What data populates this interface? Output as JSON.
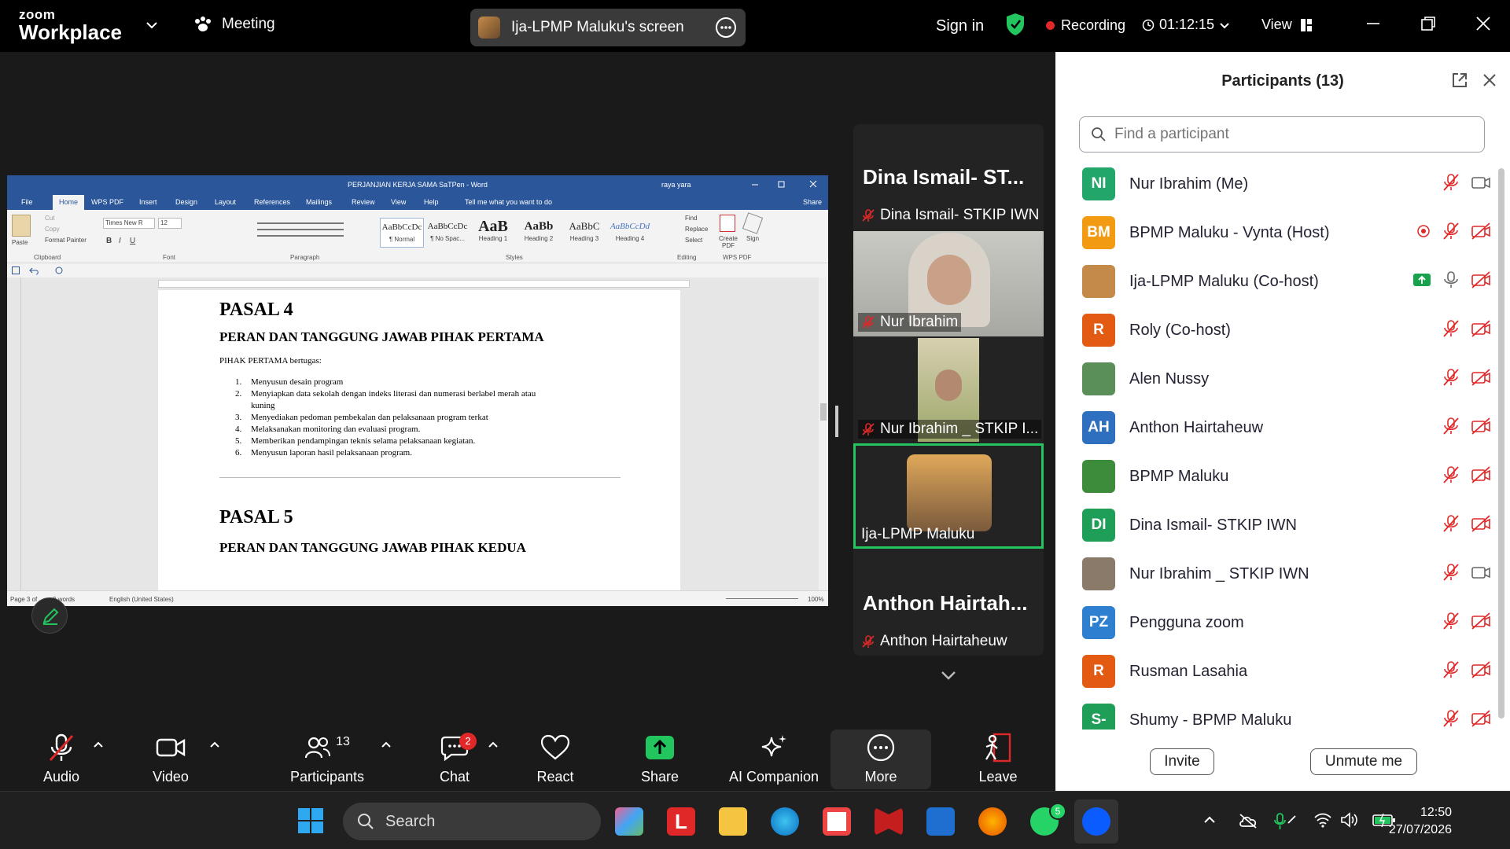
{
  "app": {
    "logo_line1": "zoom",
    "logo_line2": "Workplace",
    "meeting_label": "Meeting",
    "screen_share_label": "Ija-LPMP Maluku's screen",
    "sign_in": "Sign in",
    "recording_label": "Recording",
    "timer": "01:12:15",
    "view_label": "View"
  },
  "word": {
    "title": "PERJANJIAN KERJA SAMA SaTPen - Word",
    "user": "raya yara",
    "tabs": [
      "File",
      "Home",
      "WPS PDF",
      "Insert",
      "Design",
      "Layout",
      "References",
      "Mailings",
      "Review",
      "View",
      "Help"
    ],
    "tell_me": "Tell me what you want to do",
    "share": "Share",
    "ribbon": {
      "paste": "Paste",
      "cut": "Cut",
      "copy": "Copy",
      "format_painter": "Format Painter",
      "font_name": "Times New R",
      "font_size": "12",
      "groups": [
        "Clipboard",
        "Font",
        "Paragraph",
        "Styles",
        "Editing",
        "WPS PDF"
      ],
      "styles": [
        {
          "preview": "AaBbCcDc",
          "name": "¶ Normal"
        },
        {
          "preview": "AaBbCcDc",
          "name": "¶ No Spac..."
        },
        {
          "preview": "AaB",
          "name": "Heading 1"
        },
        {
          "preview": "AaBb",
          "name": "Heading 2"
        },
        {
          "preview": "AaBbC",
          "name": "Heading 3"
        },
        {
          "preview": "AaBbCcDd",
          "name": "Heading 4"
        }
      ],
      "find": "Find",
      "replace": "Replace",
      "select": "Select",
      "create_pdf": "Create PDF",
      "sign": "Sign"
    },
    "doc": {
      "h_pasal4": "PASAL 4",
      "h_peran1": "PERAN DAN TANGGUNG JAWAB PIHAK PERTAMA",
      "intro": "PIHAK PERTAMA bertugas:",
      "items": [
        {
          "n": "1.",
          "t": "Menyusun desain program"
        },
        {
          "n": "2.",
          "t": "Menyiapkan data  sekolah dengan indeks literasi dan numerasi berlabel merah atau"
        },
        {
          "n": "",
          "t": "kuning"
        },
        {
          "n": "3.",
          "t": "Menyediakan pedoman pembekalan dan pelaksanaan program terkat"
        },
        {
          "n": "4.",
          "t": "Melaksanakan monitoring dan evaluasi program."
        },
        {
          "n": "5.",
          "t": "Memberikan pendampingan teknis selama pelaksanaan kegiatan."
        },
        {
          "n": "6.",
          "t": "Menyusun laporan hasil pelaksanaan program."
        }
      ],
      "h_pasal5": "PASAL 5",
      "h_peran2": "PERAN DAN TANGGUNG JAWAB PIHAK KEDUA"
    },
    "status": {
      "page": "Page 3 of",
      "words": "0 words",
      "lang": "English (United States)",
      "zoom": "100%"
    }
  },
  "video_tiles": [
    {
      "big": "Dina Ismail- ST...",
      "label": "Dina Ismail- STKIP IWN"
    },
    {
      "label": "Nur Ibrahim"
    },
    {
      "label": "Nur Ibrahim _ STKIP  I..."
    },
    {
      "label": "Ija-LPMP Maluku"
    },
    {
      "big": "Anthon  Hairtah...",
      "label": "Anthon Hairtaheuw"
    }
  ],
  "participants": {
    "title": "Participants (13)",
    "search_placeholder": "Find a participant",
    "list": [
      {
        "initials": "NI",
        "color": "#22a66a",
        "name": "Nur Ibrahim (Me)",
        "cam": "on"
      },
      {
        "initials": "BM",
        "color": "#f29b12",
        "name": "BPMP Maluku - Vynta (Host)",
        "cam": "off"
      },
      {
        "initials": "",
        "color": "#c48a4a",
        "name": "Ija-LPMP Maluku (Co-host)",
        "cam": "off"
      },
      {
        "initials": "R",
        "color": "#e35a12",
        "name": "Roly (Co-host)",
        "cam": "off"
      },
      {
        "initials": "",
        "color": "#5a8f5a",
        "name": "Alen Nussy",
        "cam": "off"
      },
      {
        "initials": "AH",
        "color": "#2f6fbf",
        "name": "Anthon Hairtaheuw",
        "cam": "off"
      },
      {
        "initials": "",
        "color": "#3c8c3c",
        "name": "BPMP Maluku",
        "cam": "off"
      },
      {
        "initials": "DI",
        "color": "#1f9e57",
        "name": "Dina Ismail- STKIP IWN",
        "cam": "off"
      },
      {
        "initials": "",
        "color": "#8a7a6a",
        "name": "Nur Ibrahim _ STKIP  IWN",
        "cam": "on"
      },
      {
        "initials": "PZ",
        "color": "#2f7fd0",
        "name": "Pengguna zoom",
        "cam": "off"
      },
      {
        "initials": "R",
        "color": "#e35a12",
        "name": "Rusman Lasahia",
        "cam": "off"
      },
      {
        "initials": "S-",
        "color": "#1f9e57",
        "name": "Shumy - BPMP Maluku",
        "cam": "off"
      }
    ],
    "invite": "Invite",
    "unmute": "Unmute me"
  },
  "toolbar": {
    "audio": "Audio",
    "video": "Video",
    "participants": "Participants",
    "participants_count": "13",
    "chat": "Chat",
    "chat_badge": "2",
    "react": "React",
    "share": "Share",
    "ai": "AI Companion",
    "more": "More",
    "leave": "Leave"
  },
  "taskbar": {
    "search": "Search",
    "whatsapp_badge": "5",
    "time": "12:50",
    "date": "27/07/2026"
  }
}
